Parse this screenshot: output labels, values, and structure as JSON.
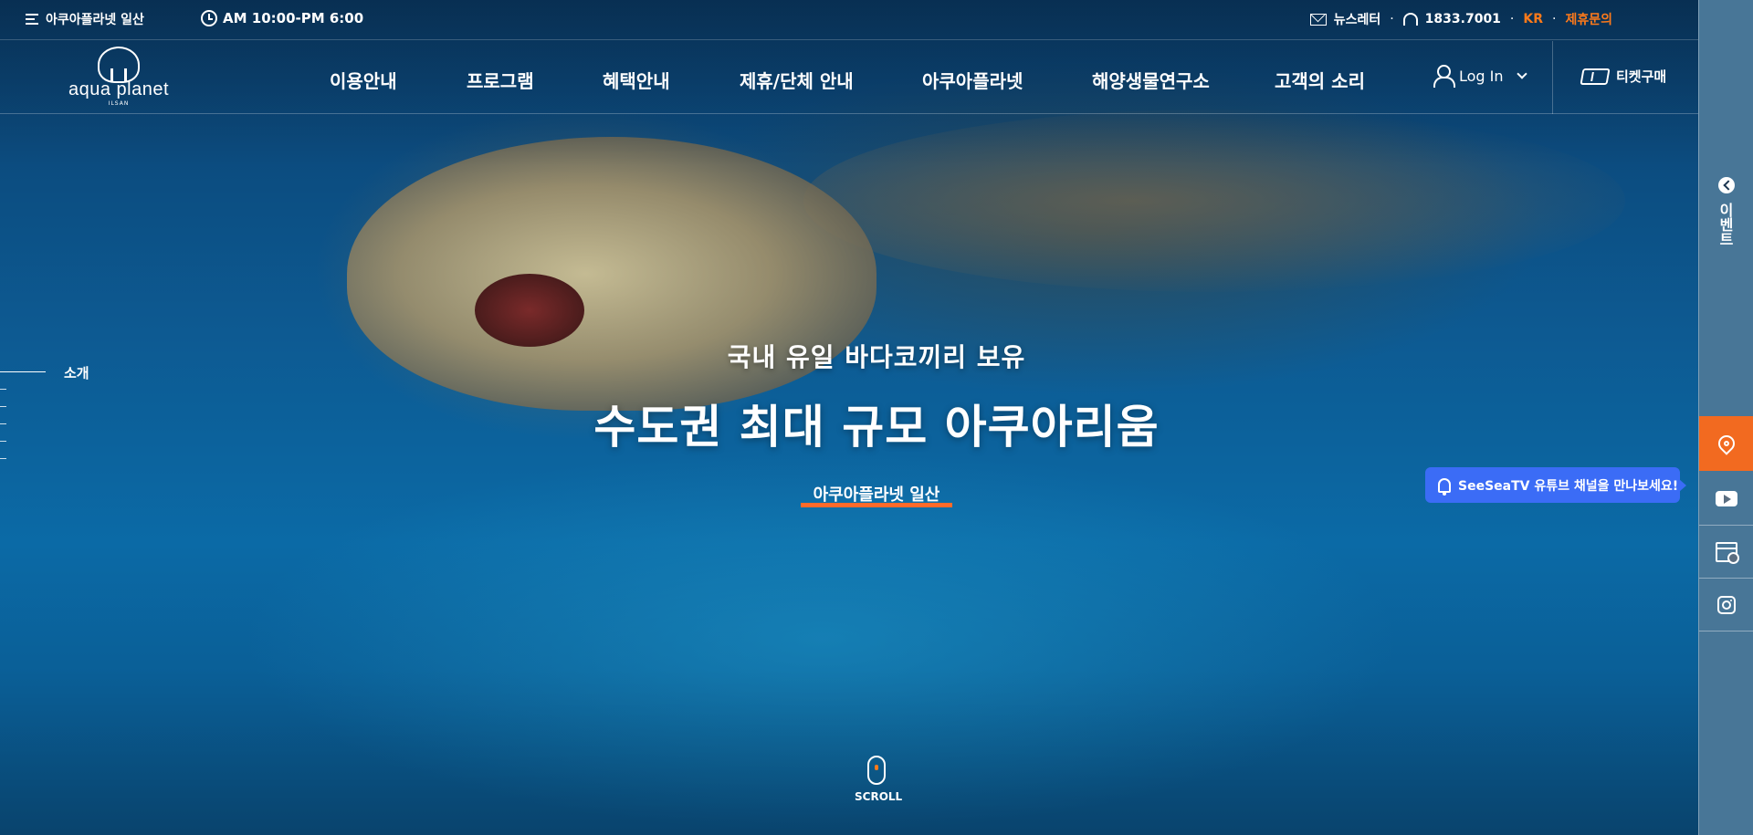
{
  "topbar": {
    "site_name": "아쿠아플라넷 일산",
    "hours": "AM 10:00-PM 6:00",
    "newsletter": "뉴스레터",
    "phone": "1833.7001",
    "language": "KR",
    "partnership": "제휴문의",
    "separator": "·"
  },
  "logo": {
    "text": "aqua planet",
    "sub": "ILSAN"
  },
  "nav": {
    "items": [
      {
        "label": "이용안내"
      },
      {
        "label": "프로그램"
      },
      {
        "label": "혜택안내"
      },
      {
        "label": "제휴/단체 안내"
      },
      {
        "label": "아쿠아플라넷"
      },
      {
        "label": "해양생물연구소"
      },
      {
        "label": "고객의 소리"
      }
    ],
    "login": "Log In",
    "ticket": "티켓구매"
  },
  "section_nav": {
    "active_label": "소개"
  },
  "hero": {
    "subtitle": "국내 유일 바다코끼리 보유",
    "title": "수도권 최대 규모 아쿠아리움",
    "link": "아쿠아플라넷 일산",
    "scroll": "SCROLL"
  },
  "sidebar": {
    "event_label": "이벤트",
    "tooltip": "SeeSeaTV 유튜브 채널을 만나보세요!",
    "map_color": "#f26a20"
  },
  "colors": {
    "accent": "#ff7a1a",
    "underline": "#ff6a2a",
    "tooltip_bg": "#3b6cf6"
  }
}
